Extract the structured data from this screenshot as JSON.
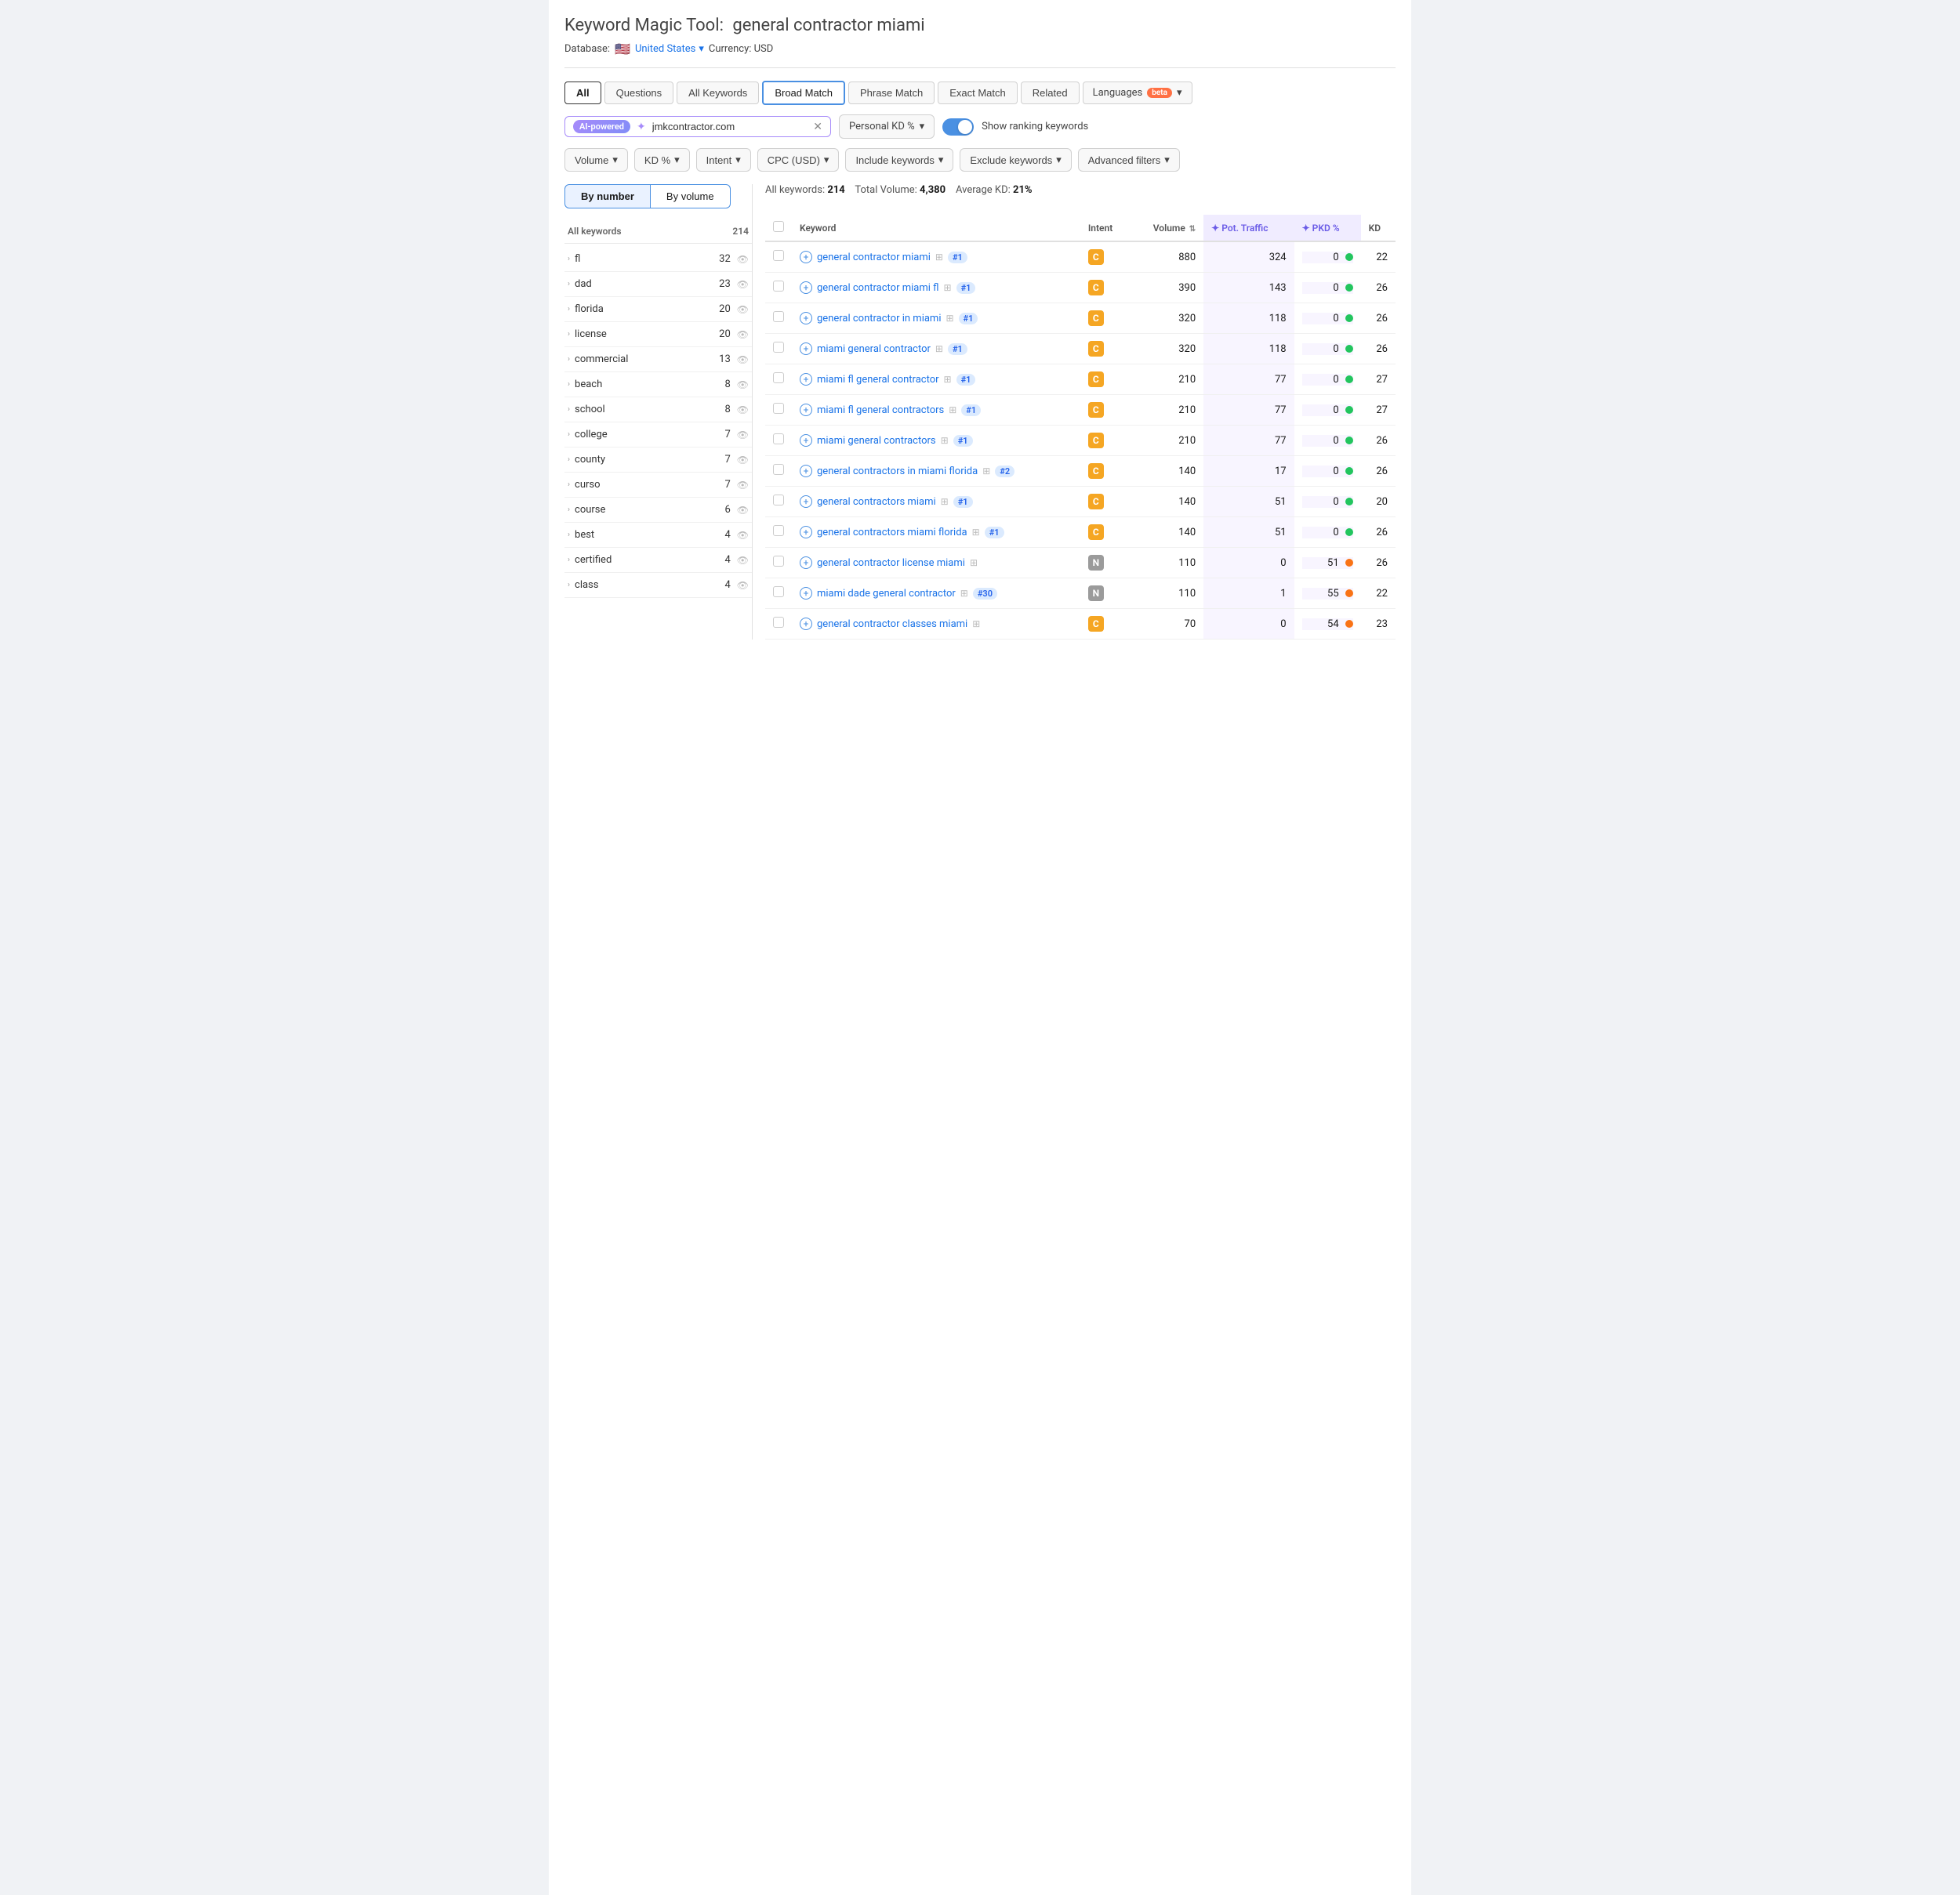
{
  "page": {
    "title": "Keyword Magic Tool:",
    "query": "general contractor miami",
    "database_label": "Database:",
    "flag": "🇺🇸",
    "country": "United States",
    "currency": "Currency: USD"
  },
  "tabs": [
    {
      "label": "All",
      "active": true
    },
    {
      "label": "Questions"
    },
    {
      "label": "All Keywords"
    },
    {
      "label": "Broad Match",
      "selected": true
    },
    {
      "label": "Phrase Match"
    },
    {
      "label": "Exact Match"
    },
    {
      "label": "Related"
    }
  ],
  "languages": {
    "label": "Languages"
  },
  "search": {
    "ai_badge": "AI-powered",
    "placeholder": "jmkcontractor.com",
    "kd_label": "Personal KD %"
  },
  "toggle": {
    "label": "Show ranking keywords"
  },
  "filters": [
    {
      "label": "Volume",
      "has_arrow": true
    },
    {
      "label": "KD %",
      "has_arrow": true
    },
    {
      "label": "Intent",
      "has_arrow": true
    },
    {
      "label": "CPC (USD)",
      "has_arrow": true
    },
    {
      "label": "Include keywords",
      "has_arrow": true
    },
    {
      "label": "Exclude keywords",
      "has_arrow": true
    },
    {
      "label": "Advanced filters",
      "has_arrow": true
    }
  ],
  "by_buttons": [
    {
      "label": "By number",
      "active": true
    },
    {
      "label": "By volume"
    }
  ],
  "sidebar": {
    "header_label": "All keywords",
    "header_count": "214",
    "items": [
      {
        "name": "fl",
        "count": 32
      },
      {
        "name": "dad",
        "count": 23
      },
      {
        "name": "florida",
        "count": 20
      },
      {
        "name": "license",
        "count": 20
      },
      {
        "name": "commercial",
        "count": 13
      },
      {
        "name": "beach",
        "count": 8
      },
      {
        "name": "school",
        "count": 8
      },
      {
        "name": "college",
        "count": 7
      },
      {
        "name": "county",
        "count": 7
      },
      {
        "name": "curso",
        "count": 7
      },
      {
        "name": "course",
        "count": 6
      },
      {
        "name": "best",
        "count": 4
      },
      {
        "name": "certified",
        "count": 4
      },
      {
        "name": "class",
        "count": 4
      }
    ]
  },
  "summary": {
    "label": "All keywords:",
    "count": "214",
    "volume_label": "Total Volume:",
    "volume": "4,380",
    "kd_label": "Average KD:",
    "kd": "21%"
  },
  "table": {
    "columns": [
      {
        "label": "",
        "key": "checkbox"
      },
      {
        "label": "Keyword",
        "key": "keyword"
      },
      {
        "label": "Intent",
        "key": "intent"
      },
      {
        "label": "Volume",
        "key": "volume",
        "sortable": true
      },
      {
        "label": "✦ Pot. Traffic",
        "key": "pot_traffic",
        "highlight": true
      },
      {
        "label": "✦ PKD %",
        "key": "pkd",
        "highlight": true
      },
      {
        "label": "KD",
        "key": "kd"
      }
    ],
    "rows": [
      {
        "keyword": "general contractor miami",
        "serp": true,
        "rank": "#1",
        "intent": "C",
        "intent_class": "intent-c",
        "volume": 880,
        "pot_traffic": 324,
        "pkd": 0,
        "pkd_dot": "green",
        "kd": 22
      },
      {
        "keyword": "general contractor miami fl",
        "serp": true,
        "rank": "#1",
        "intent": "C",
        "intent_class": "intent-c",
        "volume": 390,
        "pot_traffic": 143,
        "pkd": 0,
        "pkd_dot": "green",
        "kd": 26
      },
      {
        "keyword": "general contractor in miami",
        "serp": true,
        "rank": "#1",
        "intent": "C",
        "intent_class": "intent-c",
        "volume": 320,
        "pot_traffic": 118,
        "pkd": 0,
        "pkd_dot": "green",
        "kd": 26
      },
      {
        "keyword": "miami general contractor",
        "serp": true,
        "rank": "#1",
        "intent": "C",
        "intent_class": "intent-c",
        "volume": 320,
        "pot_traffic": 118,
        "pkd": 0,
        "pkd_dot": "green",
        "kd": 26
      },
      {
        "keyword": "miami fl general contractor",
        "serp": true,
        "rank": "#1",
        "intent": "C",
        "intent_class": "intent-c",
        "volume": 210,
        "pot_traffic": 77,
        "pkd": 0,
        "pkd_dot": "green",
        "kd": 27
      },
      {
        "keyword": "miami fl general contractors",
        "serp": true,
        "rank": "#1",
        "intent": "C",
        "intent_class": "intent-c",
        "volume": 210,
        "pot_traffic": 77,
        "pkd": 0,
        "pkd_dot": "green",
        "kd": 27
      },
      {
        "keyword": "miami general contractors",
        "serp": true,
        "rank": "#1",
        "intent": "C",
        "intent_class": "intent-c",
        "volume": 210,
        "pot_traffic": 77,
        "pkd": 0,
        "pkd_dot": "green",
        "kd": 26
      },
      {
        "keyword": "general contractors in miami florida",
        "serp": true,
        "rank": "#2",
        "intent": "C",
        "intent_class": "intent-c",
        "volume": 140,
        "pot_traffic": 17,
        "pkd": 0,
        "pkd_dot": "green",
        "kd": 26
      },
      {
        "keyword": "general contractors miami",
        "serp": true,
        "rank": "#1",
        "intent": "C",
        "intent_class": "intent-c",
        "volume": 140,
        "pot_traffic": 51,
        "pkd": 0,
        "pkd_dot": "green",
        "kd": 20
      },
      {
        "keyword": "general contractors miami florida",
        "serp": true,
        "rank": "#1",
        "intent": "C",
        "intent_class": "intent-c",
        "volume": 140,
        "pot_traffic": 51,
        "pkd": 0,
        "pkd_dot": "green",
        "kd": 26
      },
      {
        "keyword": "general contractor license miami",
        "serp": true,
        "rank": null,
        "intent": "N",
        "intent_class": "intent-n",
        "volume": 110,
        "pot_traffic": 0,
        "pkd": 51,
        "pkd_dot": "orange",
        "kd": 26
      },
      {
        "keyword": "miami dade general contractor",
        "serp": true,
        "rank": "#30",
        "intent": "N",
        "intent_class": "intent-n",
        "volume": 110,
        "pot_traffic": 1,
        "pkd": 55,
        "pkd_dot": "orange",
        "kd": 22
      },
      {
        "keyword": "general contractor classes miami",
        "serp": true,
        "rank": null,
        "intent": "C",
        "intent_class": "intent-c",
        "volume": 70,
        "pot_traffic": 0,
        "pkd": 54,
        "pkd_dot": "orange",
        "kd": 23
      }
    ]
  }
}
